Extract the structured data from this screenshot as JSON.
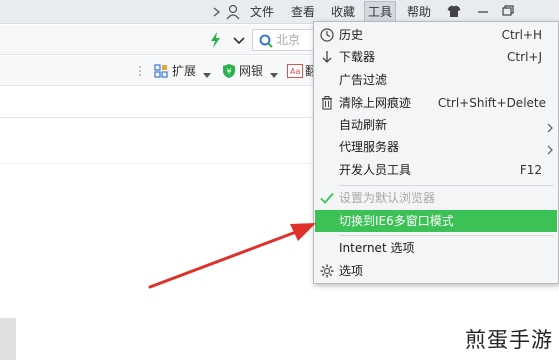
{
  "titlebar": {
    "menus": {
      "file": "文件",
      "view": "查看",
      "favorites": "收藏",
      "tools": "工具",
      "help": "帮助"
    }
  },
  "address": {
    "search_placeholder": "北京"
  },
  "toolbar": {
    "extensions": "扩展",
    "netbank": "网银",
    "translate": "翻"
  },
  "menu": {
    "items": [
      {
        "label": "历史",
        "shortcut": "Ctrl+H",
        "icon": "clock-icon"
      },
      {
        "label": "下载器",
        "shortcut": "Ctrl+J",
        "icon": "download-icon"
      },
      {
        "label": "广告过滤",
        "shortcut": ""
      },
      {
        "label": "清除上网痕迹",
        "shortcut": "Ctrl+Shift+Delete",
        "icon": "trash-icon"
      },
      {
        "label": "自动刷新",
        "shortcut": "",
        "submenu": true
      },
      {
        "label": "代理服务器",
        "shortcut": "",
        "submenu": true
      },
      {
        "label": "开发人员工具",
        "shortcut": "F12"
      },
      {
        "label": "设置为默认浏览器",
        "shortcut": "",
        "disabled": true,
        "icon": "checkmark-icon"
      },
      {
        "label": "切换到IE6多窗口模式",
        "shortcut": "",
        "highlighted": true
      },
      {
        "label": "Internet 选项",
        "shortcut": ""
      },
      {
        "label": "选项",
        "shortcut": "",
        "icon": "gear-icon"
      }
    ]
  },
  "colors": {
    "highlight": "#3cc157",
    "annotation_arrow": "#e0302a",
    "check_green": "#3cc157",
    "bolt_green": "#2bb24c"
  },
  "watermark": "煎蛋手游"
}
